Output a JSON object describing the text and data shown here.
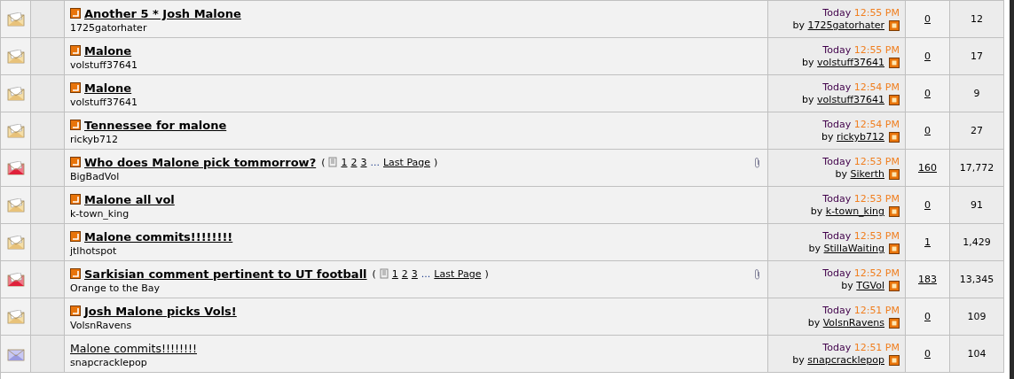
{
  "threads": [
    {
      "kind": "normal",
      "unread": true,
      "title": "Another 5 * Josh Malone",
      "author": "1725gatorhater",
      "attachment": false,
      "date": "Today",
      "time": "12:55 PM",
      "by": "by",
      "last_by": "1725gatorhater",
      "replies": "0",
      "views": "12"
    },
    {
      "kind": "normal",
      "unread": true,
      "title": "Malone",
      "author": "volstuff37641",
      "attachment": false,
      "date": "Today",
      "time": "12:55 PM",
      "by": "by",
      "last_by": "volstuff37641",
      "replies": "0",
      "views": "17"
    },
    {
      "kind": "normal",
      "unread": true,
      "title": "Malone",
      "author": "volstuff37641",
      "attachment": false,
      "date": "Today",
      "time": "12:54 PM",
      "by": "by",
      "last_by": "volstuff37641",
      "replies": "0",
      "views": "9"
    },
    {
      "kind": "normal",
      "unread": true,
      "title": "Tennessee for malone",
      "author": "rickyb712",
      "attachment": false,
      "date": "Today",
      "time": "12:54 PM",
      "by": "by",
      "last_by": "rickyb712",
      "replies": "0",
      "views": "27"
    },
    {
      "kind": "hot",
      "unread": true,
      "title": "Who does Malone pick tommorrow?",
      "paren_open": "(",
      "pages": [
        "1",
        "2",
        "3"
      ],
      "ellipsis": "...",
      "last_page": "Last Page",
      "paren_close": ")",
      "author": "BigBadVol",
      "attachment": true,
      "date": "Today",
      "time": "12:53 PM",
      "by": "by",
      "last_by": "Sikerth",
      "replies": "160",
      "views": "17,772"
    },
    {
      "kind": "normal",
      "unread": true,
      "title": "Malone all vol",
      "author": "k-town_king",
      "attachment": false,
      "date": "Today",
      "time": "12:53 PM",
      "by": "by",
      "last_by": "k-town_king",
      "replies": "0",
      "views": "91"
    },
    {
      "kind": "normal",
      "unread": true,
      "title": "Malone commits!!!!!!!!",
      "author": "jtlhotspot",
      "attachment": false,
      "date": "Today",
      "time": "12:53 PM",
      "by": "by",
      "last_by": "StillaWaiting",
      "replies": "1",
      "views": "1,429"
    },
    {
      "kind": "hot",
      "unread": true,
      "title": "Sarkisian comment pertinent to UT football",
      "paren_open": "(",
      "pages": [
        "1",
        "2",
        "3"
      ],
      "ellipsis": "...",
      "last_page": "Last Page",
      "paren_close": ")",
      "author": "Orange to the Bay",
      "attachment": true,
      "date": "Today",
      "time": "12:52 PM",
      "by": "by",
      "last_by": "TGVol",
      "replies": "183",
      "views": "13,345"
    },
    {
      "kind": "normal",
      "unread": true,
      "title": "Josh Malone picks Vols!",
      "author": "VolsnRavens",
      "attachment": false,
      "date": "Today",
      "time": "12:51 PM",
      "by": "by",
      "last_by": "VolsnRavens",
      "replies": "0",
      "views": "109"
    },
    {
      "kind": "read",
      "unread": false,
      "title": "Malone  commits!!!!!!!!",
      "author": "snapcracklepop",
      "attachment": false,
      "date": "Today",
      "time": "12:51 PM",
      "by": "by",
      "last_by": "snapcracklepop",
      "replies": "0",
      "views": "104"
    }
  ]
}
